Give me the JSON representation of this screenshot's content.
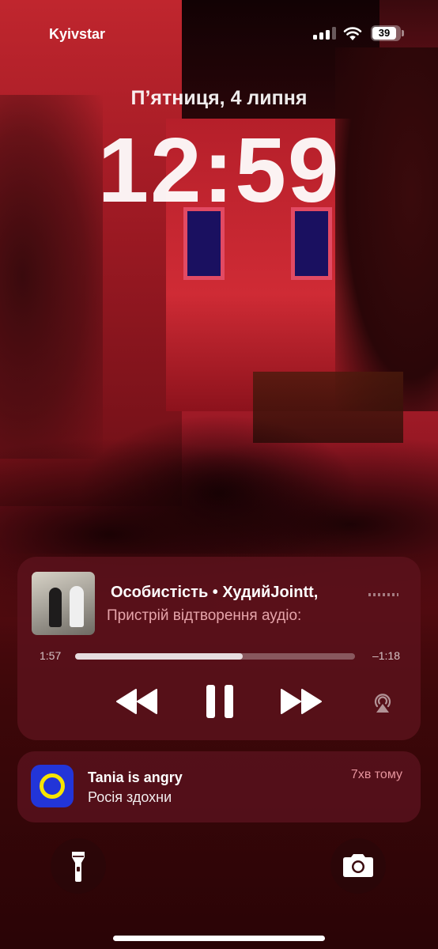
{
  "status_bar": {
    "carrier": "Kyivstar",
    "battery_level": "39",
    "signal_bars": 3,
    "icons": [
      "signal-bars-icon",
      "wifi-icon",
      "battery-icon"
    ]
  },
  "lock_screen": {
    "date": "П’ятниця, 4 липня",
    "time": "12:59"
  },
  "now_playing": {
    "track_title": "Особистість • ХудийJointt,",
    "subtitle": "Пристрій відтворення аудіо:",
    "elapsed": "1:57",
    "remaining": "–1:18",
    "progress_fraction": 0.6,
    "controls": [
      "rewind-icon",
      "pause-icon",
      "fast-forward-icon",
      "airplay-icon"
    ]
  },
  "notification": {
    "title": "Tania is angry",
    "body": "Росія здохни",
    "time": "7хв тому",
    "icon_colors": {
      "background": "#2235d8",
      "ring": "#f7e500"
    }
  },
  "quick_actions": {
    "left": "flashlight-icon",
    "right": "camera-icon"
  }
}
